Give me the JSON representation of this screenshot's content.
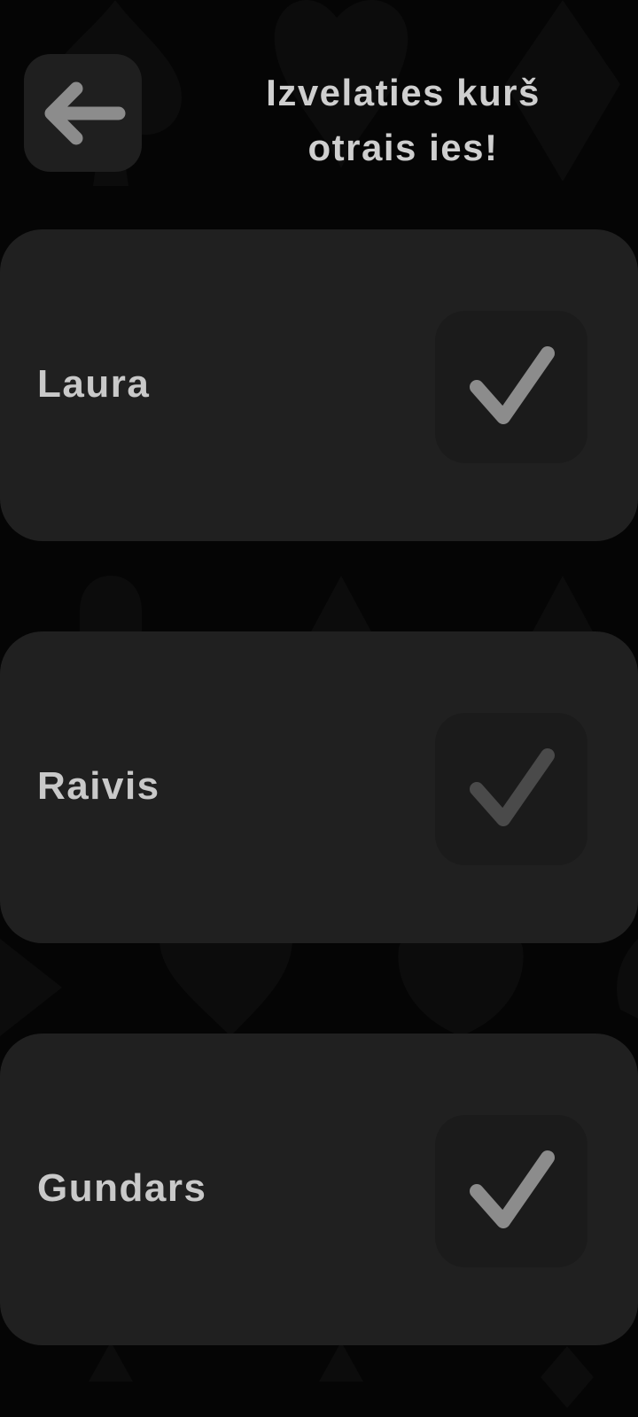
{
  "header": {
    "back_icon": "arrow-left-icon",
    "title": "Izvelaties kurš\notrais ies!"
  },
  "players": [
    {
      "name": "Laura",
      "checked": true,
      "check_icon": "checkmark-icon"
    },
    {
      "name": "Raivis",
      "checked": false,
      "check_icon": "checkmark-icon"
    },
    {
      "name": "Gundars",
      "checked": true,
      "check_icon": "checkmark-icon"
    }
  ],
  "colors": {
    "background": "#050505",
    "card": "#202020",
    "checkbox": "#1b1b1b",
    "check_active": "#8c8c8c",
    "check_inactive": "#4a4a4a",
    "text": "#c9c9c9"
  }
}
